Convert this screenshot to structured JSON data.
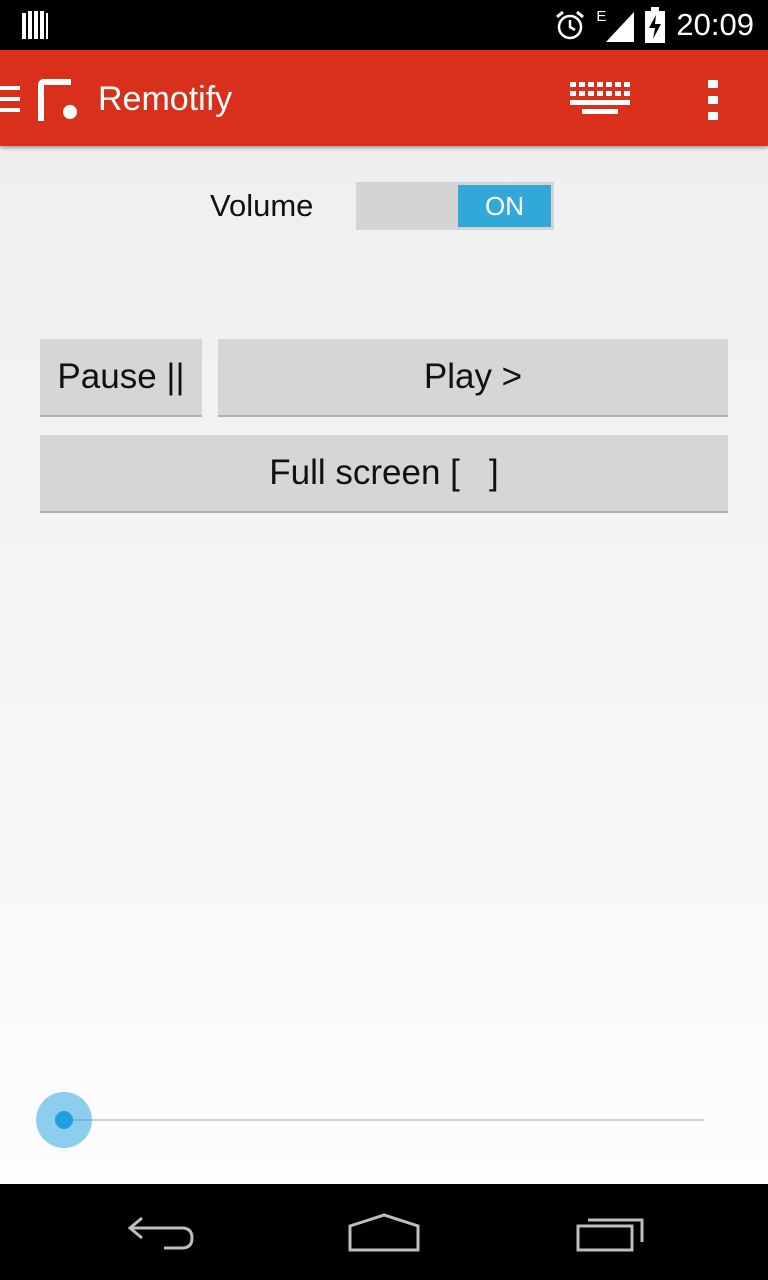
{
  "status_bar": {
    "time": "20:09",
    "network_type": "E",
    "icons": [
      "notification-bars-icon",
      "alarm-icon",
      "signal-icon",
      "battery-charging-icon"
    ]
  },
  "action_bar": {
    "title": "Remotify",
    "background_color": "#d9301c",
    "icons": [
      "drawer-menu-icon",
      "remotify-logo",
      "keyboard-icon",
      "overflow-menu-icon"
    ]
  },
  "volume": {
    "label": "Volume",
    "toggle_state": "ON",
    "accent_color": "#32a8d8"
  },
  "controls": {
    "pause_label": "Pause ||",
    "play_label": "Play >",
    "fullscreen_label": "Full screen [   ]"
  },
  "seekbar": {
    "progress": 0
  },
  "nav_bar": {
    "icons": [
      "back-icon",
      "home-icon",
      "recent-apps-icon"
    ]
  }
}
